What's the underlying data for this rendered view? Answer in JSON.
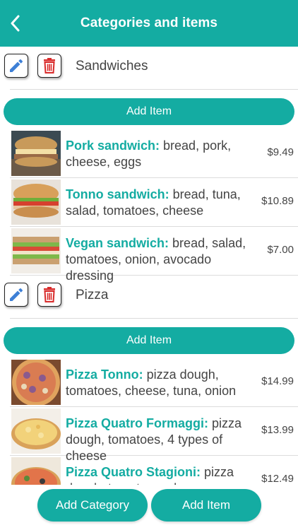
{
  "header": {
    "title": "Categories and items",
    "back_icon": "chevron-left-icon"
  },
  "colors": {
    "accent": "#14aca2",
    "delete": "#d92b2b",
    "edit": "#3d7fd6"
  },
  "categories": [
    {
      "name": "Sandwiches",
      "add_item_label": "Add Item",
      "items": [
        {
          "name": "Pork sandwich:",
          "desc": " bread, pork, cheese, eggs",
          "price": "$9.49"
        },
        {
          "name": "Tonno sandwich:",
          "desc": " bread, tuna, salad, tomatoes, cheese",
          "price": "$10.89"
        },
        {
          "name": "Vegan sandwich:",
          "desc": " bread, salad, tomatoes, onion, avocado dressing",
          "price": "$7.00"
        }
      ]
    },
    {
      "name": "Pizza",
      "add_item_label": "Add Item",
      "items": [
        {
          "name": "Pizza Tonno:",
          "desc": " pizza dough, tomatoes, cheese, tuna, onion",
          "price": "$14.99"
        },
        {
          "name": "Pizza Quatro Formaggi:",
          "desc": " pizza dough, tomatoes, 4 types of cheese",
          "price": "$13.99"
        },
        {
          "name": "Pizza Quatro Stagioni:",
          "desc": " pizza dough, tomatoes, cheese,",
          "price": "$12.49"
        }
      ]
    }
  ],
  "bottom": {
    "add_category_label": "Add Category",
    "add_item_label": "Add Item"
  }
}
